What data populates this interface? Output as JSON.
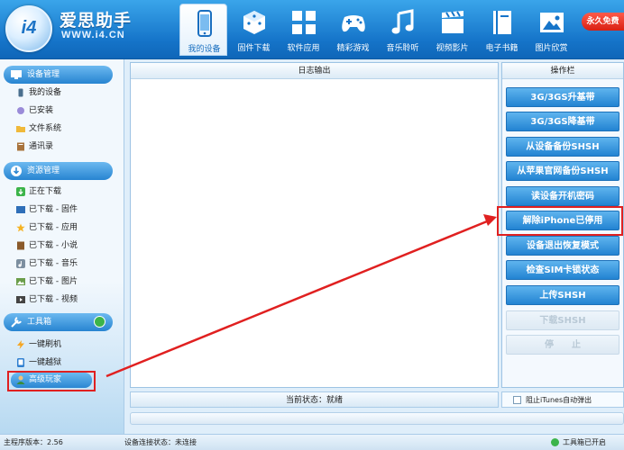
{
  "app": {
    "brand": "爱思助手",
    "url": "WWW.i4.CN",
    "logo_text": "i4",
    "badge": "永久免费"
  },
  "nav": [
    {
      "label": "我的设备",
      "icon": "phone-icon",
      "active": true
    },
    {
      "label": "固件下载",
      "icon": "cube-icon"
    },
    {
      "label": "软件应用",
      "icon": "apps-grid-icon"
    },
    {
      "label": "精彩游戏",
      "icon": "gamepad-icon"
    },
    {
      "label": "音乐聆听",
      "icon": "music-note-icon"
    },
    {
      "label": "视频影片",
      "icon": "clapperboard-icon"
    },
    {
      "label": "电子书籍",
      "icon": "book-icon"
    },
    {
      "label": "图片欣赏",
      "icon": "picture-icon"
    }
  ],
  "sidebar": {
    "device_mgmt": {
      "title": "设备管理",
      "icon": "monitor-icon",
      "items": [
        {
          "label": "我的设备",
          "icon": "phone-icon"
        },
        {
          "label": "已安装",
          "icon": "installed-icon"
        },
        {
          "label": "文件系统",
          "icon": "folder-icon"
        },
        {
          "label": "通讯录",
          "icon": "contacts-icon"
        }
      ]
    },
    "resource_mgmt": {
      "title": "资源管理",
      "icon": "download-circle-icon",
      "items": [
        {
          "label": "正在下载",
          "icon": "download-icon"
        },
        {
          "label": "已下载 - 固件",
          "icon": "ios-icon"
        },
        {
          "label": "已下载 - 应用",
          "icon": "star-icon"
        },
        {
          "label": "已下载 - 小说",
          "icon": "book-icon"
        },
        {
          "label": "已下载 - 音乐",
          "icon": "music-icon"
        },
        {
          "label": "已下载 - 图片",
          "icon": "image-icon"
        },
        {
          "label": "已下载 - 视频",
          "icon": "video-icon"
        }
      ]
    },
    "toolbox": {
      "title": "工具箱",
      "icon": "tools-icon",
      "items": [
        {
          "label": "一键刷机",
          "icon": "lightning-icon"
        },
        {
          "label": "一键越狱",
          "icon": "jailbreak-icon"
        },
        {
          "label": "高级玩家",
          "icon": "user-icon",
          "selected": true
        }
      ]
    }
  },
  "log": {
    "title": "日志输出",
    "status": "当前状态：就绪"
  },
  "ops": {
    "title": "操作栏",
    "buttons": [
      {
        "label": "3G/3GS升基带"
      },
      {
        "label": "3G/3GS降基带"
      },
      {
        "label": "从设备备份SHSH"
      },
      {
        "label": "从苹果官网备份SHSH"
      },
      {
        "label": "读设备开机密码"
      },
      {
        "label": "解除iPhone已停用",
        "highlighted": true
      },
      {
        "label": "设备退出恢复模式"
      },
      {
        "label": "检查SIM卡锁状态"
      },
      {
        "label": "上传SHSH"
      },
      {
        "label": "下载SHSH",
        "disabled": true
      },
      {
        "label": "停　　止",
        "disabled": true
      }
    ]
  },
  "itunes": {
    "label": "阻止iTunes自动弹出",
    "checked": false
  },
  "footer": {
    "version": "主程序版本：2.56",
    "connection": "设备连接状态：未连接",
    "toolbox": "工具箱已开启"
  },
  "colors": {
    "header": "#1574c9",
    "button": "#2283d2",
    "highlight": "#e02020",
    "ok": "#3cb44a"
  }
}
